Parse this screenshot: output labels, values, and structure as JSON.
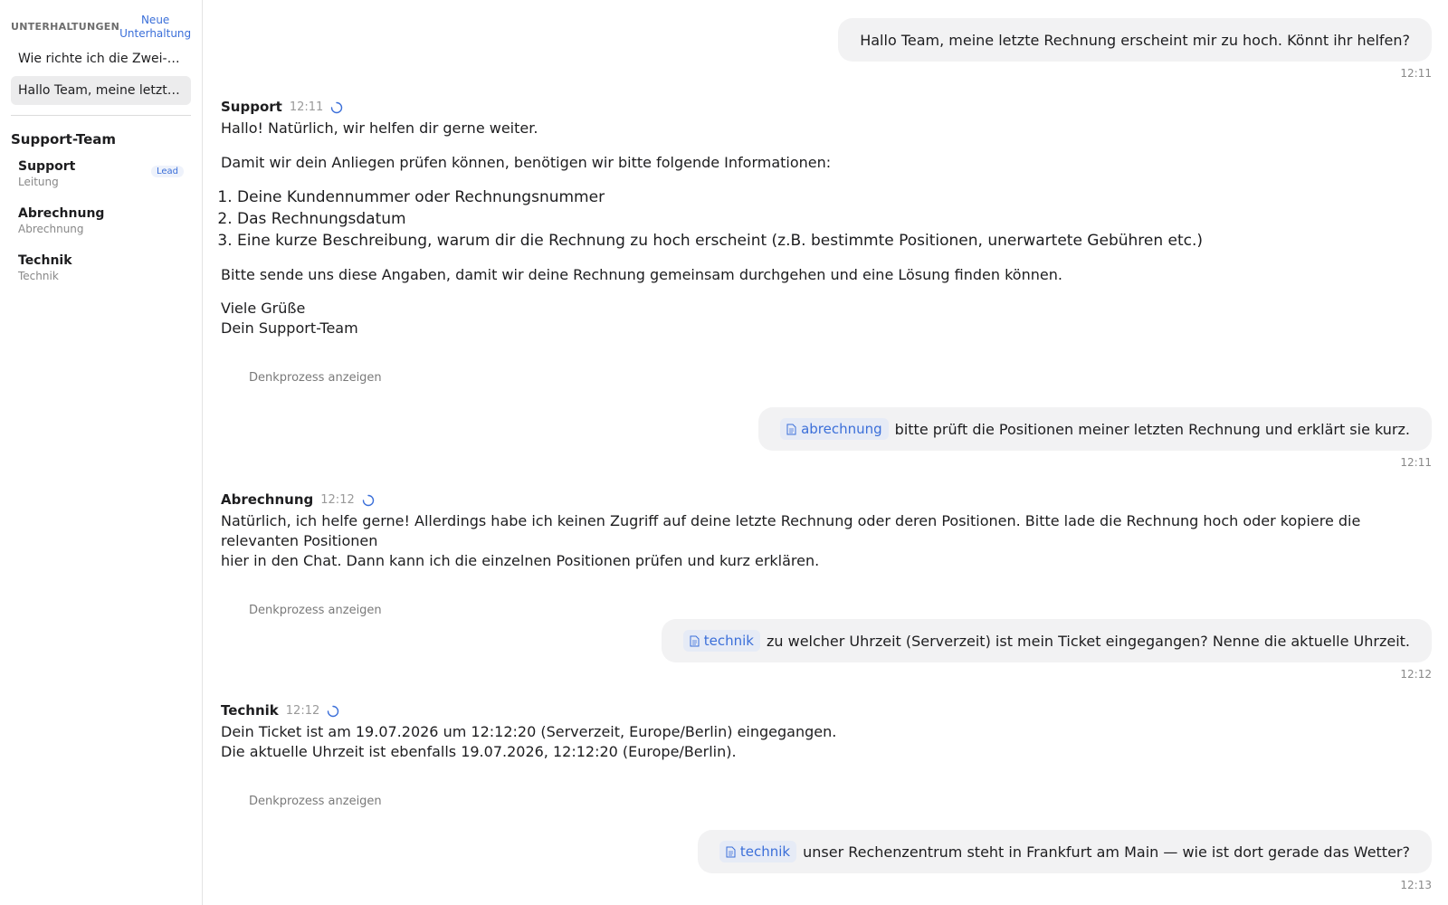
{
  "sidebar": {
    "header_title": "UNTERHALTUNGEN",
    "new_conversation_label": "Neue Unterhaltung",
    "conversations": [
      {
        "label": "Wie richte ich die Zwei-Faktor-Authentifizierung ein?"
      },
      {
        "label": "Hallo Team, meine letzte Rechnung erscheint mir zu hoch."
      }
    ],
    "team_title": "Support-Team",
    "members": [
      {
        "name": "Support",
        "role": "Leitung",
        "badge": "Lead"
      },
      {
        "name": "Abrechnung",
        "role": "Abrechnung"
      },
      {
        "name": "Technik",
        "role": "Technik"
      }
    ]
  },
  "chat": {
    "msg1": {
      "text": "Hallo Team, meine letzte Rechnung erscheint mir zu hoch. Könnt ihr helfen?",
      "time": "12:11"
    },
    "reply1": {
      "agent": "Support",
      "time": "12:11",
      "greeting": "Hallo! Natürlich, wir helfen dir gerne weiter.",
      "intro": "Damit wir dein Anliegen prüfen können, benötigen wir bitte folgende Informationen:",
      "list": [
        "Deine Kundennummer oder Rechnungsnummer",
        "Das Rechnungsdatum",
        "Eine kurze Beschreibung, warum dir die Rechnung zu hoch erscheint (z.B. bestimmte Positionen, unerwartete Gebühren etc.)"
      ],
      "outro": "Bitte sende uns diese Angaben, damit wir deine Rechnung gemeinsam durchgehen und eine Lösung finden können.",
      "sign1": "Viele Grüße",
      "sign2": "Dein Support-Team",
      "think": "Denkprozess anzeigen"
    },
    "msg2": {
      "tag": "abrechnung",
      "text": "bitte prüft die Positionen meiner letzten Rechnung und erklärt sie kurz.",
      "time": "12:11"
    },
    "reply2": {
      "agent": "Abrechnung",
      "time": "12:12",
      "line1": "Natürlich, ich helfe gerne! Allerdings habe ich keinen Zugriff auf deine letzte Rechnung oder deren Positionen. Bitte lade die Rechnung hoch oder kopiere die relevanten Positionen",
      "line2": "hier in den Chat. Dann kann ich die einzelnen Positionen prüfen und kurz erklären.",
      "think": "Denkprozess anzeigen"
    },
    "msg3": {
      "tag": "technik",
      "text": "zu welcher Uhrzeit (Serverzeit) ist mein Ticket eingegangen? Nenne die aktuelle Uhrzeit.",
      "time": "12:12"
    },
    "reply3": {
      "agent": "Technik",
      "time": "12:12",
      "line1": "Dein Ticket ist am 19.07.2026 um 12:12:20 (Serverzeit, Europe/Berlin) eingegangen.",
      "line2": "Die aktuelle Uhrzeit ist ebenfalls 19.07.2026, 12:12:20 (Europe/Berlin).",
      "think": "Denkprozess anzeigen"
    },
    "msg4": {
      "tag": "technik",
      "text": "unser Rechenzentrum steht in Frankfurt am Main — wie ist dort gerade das Wetter?",
      "time": "12:13"
    }
  },
  "colors": {
    "accent": "#3b6fd9",
    "bubble": "#f2f2f3",
    "active_item": "#ececed"
  },
  "icons": {
    "tag": "document-icon",
    "status": "spinner-icon"
  }
}
